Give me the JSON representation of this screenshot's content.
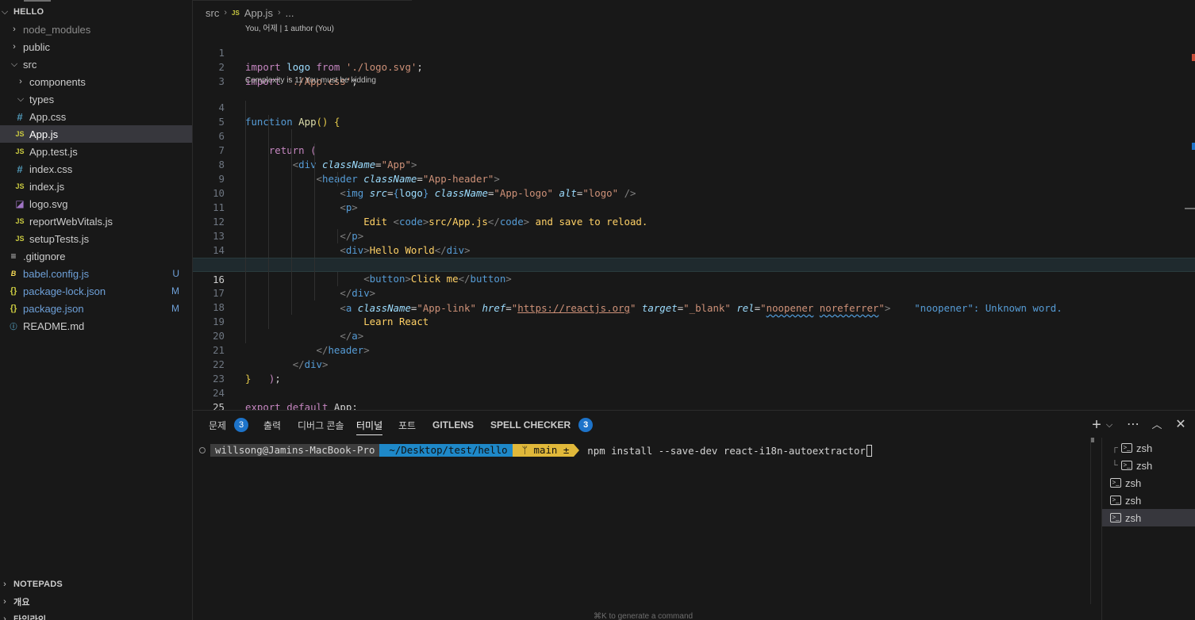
{
  "sidebar": {
    "root": "HELLO",
    "items": [
      {
        "label": "node_modules",
        "kind": "folder",
        "expanded": false,
        "icon": "chevron-right-icon",
        "dim": true
      },
      {
        "label": "public",
        "kind": "folder",
        "expanded": false,
        "icon": "chevron-right-icon"
      },
      {
        "label": "src",
        "kind": "folder",
        "expanded": true,
        "icon": "chevron-down-icon"
      },
      {
        "label": "components",
        "kind": "folder",
        "expanded": false,
        "icon": "chevron-right-icon"
      },
      {
        "label": "types",
        "kind": "folder",
        "expanded": true,
        "icon": "chevron-down-icon"
      },
      {
        "label": "App.css",
        "kind": "file",
        "icon": "css-file-icon"
      },
      {
        "label": "App.js",
        "kind": "file",
        "icon": "js-file-icon",
        "selected": true
      },
      {
        "label": "App.test.js",
        "kind": "file",
        "icon": "js-file-icon"
      },
      {
        "label": "index.css",
        "kind": "file",
        "icon": "css-file-icon"
      },
      {
        "label": "index.js",
        "kind": "file",
        "icon": "js-file-icon"
      },
      {
        "label": "logo.svg",
        "kind": "file",
        "icon": "svg-file-icon"
      },
      {
        "label": "reportWebVitals.js",
        "kind": "file",
        "icon": "js-file-icon"
      },
      {
        "label": "setupTests.js",
        "kind": "file",
        "icon": "js-file-icon"
      },
      {
        "label": ".gitignore",
        "kind": "file",
        "icon": "gitignore-file-icon"
      },
      {
        "label": "babel.config.js",
        "kind": "file",
        "icon": "babel-file-icon",
        "badge": "U"
      },
      {
        "label": "package-lock.json",
        "kind": "file",
        "icon": "json-file-icon",
        "badge": "M"
      },
      {
        "label": "package.json",
        "kind": "file",
        "icon": "json-file-icon",
        "badge": "M"
      },
      {
        "label": "README.md",
        "kind": "file",
        "icon": "info-file-icon"
      }
    ],
    "sections": [
      "NOTEPADS",
      "개요",
      "타임라인"
    ]
  },
  "editor": {
    "breadcrumb": [
      "src",
      "App.js",
      "..."
    ],
    "blame_lens": "You, 어제 | 1 author (You)",
    "complexity_lens": "Complexity is 11 You must be kidding",
    "current_line": 16,
    "diagnostic": "\"noopener\": Unknown word."
  },
  "panel": {
    "tabs": [
      {
        "label": "문제",
        "count": "3"
      },
      {
        "label": "출력"
      },
      {
        "label": "디버그 콘솔"
      },
      {
        "label": "터미널",
        "active": true
      },
      {
        "label": "포트"
      },
      {
        "label": "GITLENS"
      },
      {
        "label": "SPELL CHECKER",
        "count": "3"
      }
    ],
    "terminal": {
      "user": "willsong@Jamins-MacBook-Pro",
      "path": "~/Desktop/test/hello",
      "git": "ᛘ main ±",
      "command": "npm install --save-dev react-i18n-autoextractor",
      "hint": "⌘K to generate a command"
    },
    "terminal_list": [
      "zsh",
      "zsh",
      "zsh",
      "zsh",
      "zsh"
    ]
  },
  "colors": {
    "accent": "#1d73c9",
    "selection": "#37373d",
    "background": "#181818"
  }
}
